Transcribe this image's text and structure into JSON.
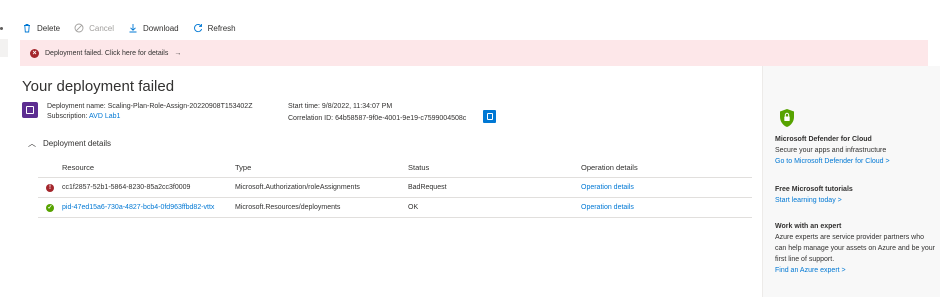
{
  "toolbar": {
    "delete": "Delete",
    "cancel": "Cancel",
    "download": "Download",
    "refresh": "Refresh"
  },
  "banner": {
    "text": "Deployment failed. Click here for details",
    "arrow": "→"
  },
  "title": "Your deployment failed",
  "deployment": {
    "name_label": "Deployment name:",
    "name": "Scaling-Plan-Role-Assign-20220908T153402Z",
    "subscription_label": "Subscription:",
    "subscription": "AVD Lab1",
    "start_label": "Start time:",
    "start": "9/8/2022, 11:34:07 PM",
    "correlation_label": "Correlation ID:",
    "correlation": "64b58587-9f0e-4001-9e19-c7599004508c"
  },
  "details": {
    "toggle_label": "Deployment details",
    "columns": [
      "Resource",
      "Type",
      "Status",
      "Operation details"
    ],
    "rows": [
      {
        "status_icon": "error-icon",
        "resource": "cc1f2857-52b1-5864-8230-85a2cc3f0009",
        "type": "Microsoft.Authorization/roleAssignments",
        "status": "BadRequest",
        "op": "Operation details"
      },
      {
        "status_icon": "success-icon",
        "resource": "pid-47ed15a6-730a-4827-bcb4-0fd963ffbd82-vttx",
        "type": "Microsoft.Resources/deployments",
        "status": "OK",
        "op": "Operation details"
      }
    ]
  },
  "side": {
    "defender_title": "Microsoft Defender for Cloud",
    "defender_text": "Secure your apps and infrastructure",
    "defender_link": "Go to Microsoft Defender for Cloud >",
    "tutorials_title": "Free Microsoft tutorials",
    "tutorials_link": "Start learning today >",
    "expert_title": "Work with an expert",
    "expert_text": "Azure experts are service provider partners who can help manage your assets on Azure and be your first line of support.",
    "expert_link": "Find an Azure expert >"
  },
  "colors": {
    "accent": "#0078d4",
    "error": "#a4262c",
    "success": "#57a300",
    "banner_bg": "#fde7e9"
  }
}
